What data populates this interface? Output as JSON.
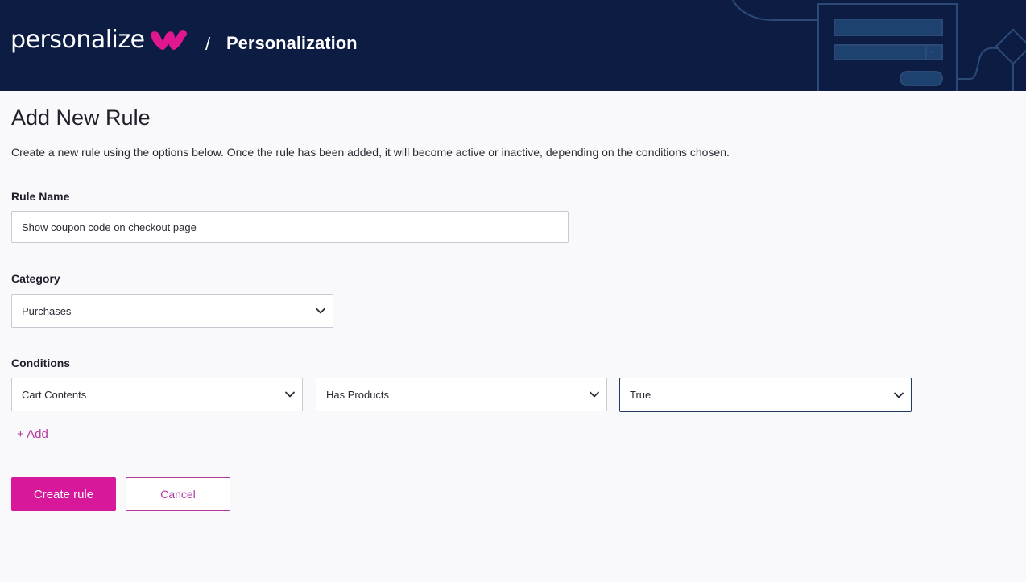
{
  "header": {
    "brand": "personalize",
    "separator": "/",
    "section_title": "Personalization"
  },
  "page": {
    "title": "Add New Rule",
    "description": "Create a new rule using the options below. Once the rule has been added, it will become active or inactive, depending on the conditions chosen."
  },
  "form": {
    "rule_name": {
      "label": "Rule Name",
      "value": "Show coupon code on checkout page"
    },
    "category": {
      "label": "Category",
      "selected": "Purchases"
    },
    "conditions": {
      "label": "Conditions",
      "rows": [
        {
          "field": "Cart Contents",
          "operator": "Has Products",
          "value": "True"
        }
      ],
      "add_label": "+ Add"
    }
  },
  "actions": {
    "create_label": "Create rule",
    "cancel_label": "Cancel"
  },
  "colors": {
    "header_bg": "#0c1c43",
    "accent": "#d8189a",
    "accent_text": "#b23a9e",
    "page_bg": "#f9f9fc"
  },
  "icons": {
    "select": "chevron-down-icon",
    "logo": "brand-logo-icon"
  }
}
